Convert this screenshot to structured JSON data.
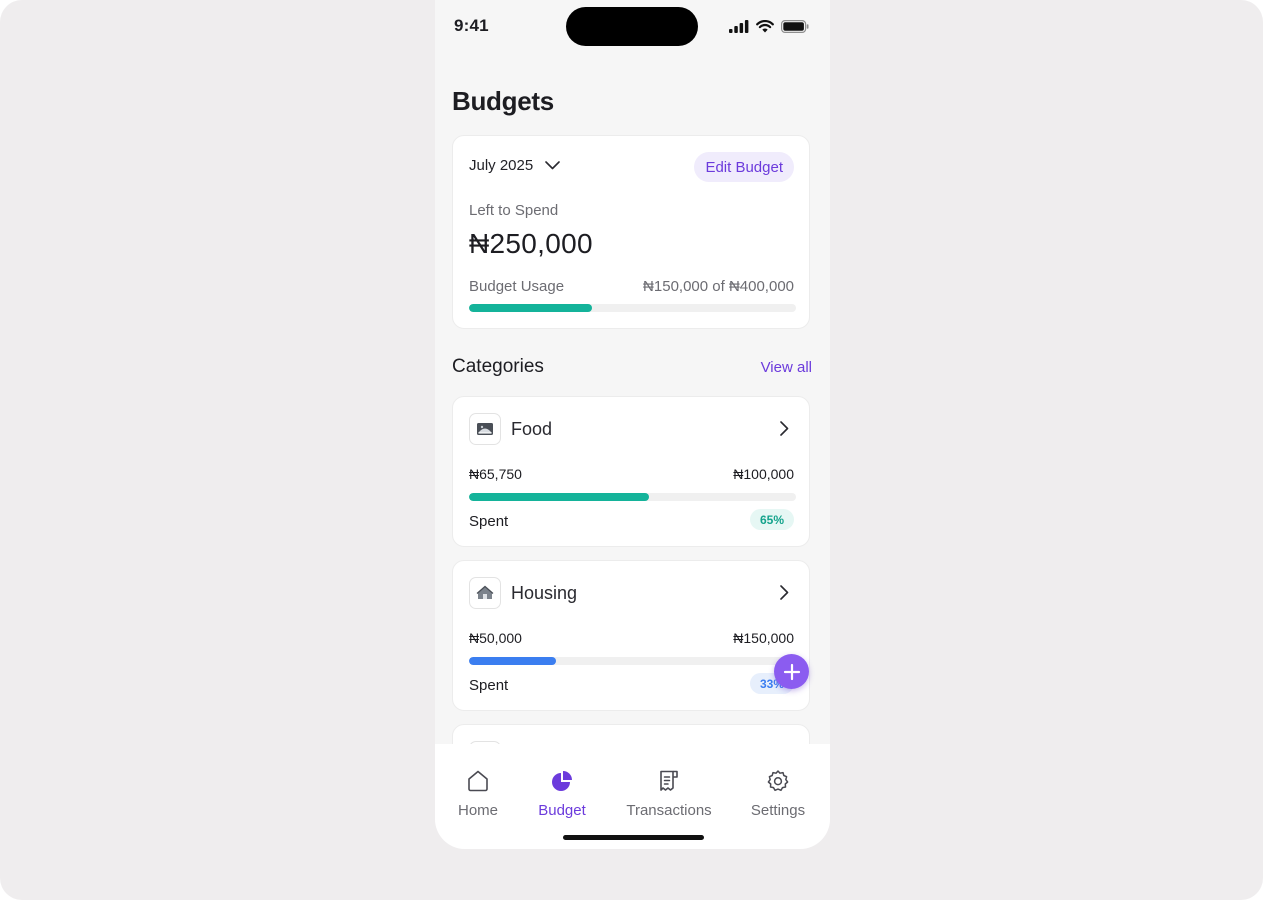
{
  "status": {
    "time": "9:41"
  },
  "page": {
    "title": "Budgets"
  },
  "summary": {
    "month": "July 2025",
    "edit_label": "Edit Budget",
    "left_label": "Left to Spend",
    "left_amount": "₦250,000",
    "usage_label": "Budget Usage",
    "usage_value": "₦150,000 of ₦400,000",
    "usage_fraction": 0.375,
    "usage_color": "#14b39a"
  },
  "categories": {
    "title": "Categories",
    "view_all": "View all",
    "items": [
      {
        "name": "Food",
        "spent": "₦65,750",
        "budget": "₦100,000",
        "spent_label": "Spent",
        "percent": "65%",
        "fraction": 0.55,
        "bar_color": "#14b39a",
        "badge_bg": "#e6f7f4",
        "badge_color": "#14a38c"
      },
      {
        "name": "Housing",
        "spent": "₦50,000",
        "budget": "₦150,000",
        "spent_label": "Spent",
        "percent": "33%",
        "fraction": 0.265,
        "bar_color": "#3b7ef0",
        "badge_bg": "#e7effc",
        "badge_color": "#3b7ef0"
      }
    ]
  },
  "tabs": [
    {
      "label": "Home",
      "icon": "home-icon",
      "active": false
    },
    {
      "label": "Budget",
      "icon": "pie-chart-icon",
      "active": true
    },
    {
      "label": "Transactions",
      "icon": "receipt-icon",
      "active": false
    },
    {
      "label": "Settings",
      "icon": "gear-icon",
      "active": false
    }
  ],
  "colors": {
    "accent": "#6c3bdc",
    "fab": "#8b5cf0"
  }
}
